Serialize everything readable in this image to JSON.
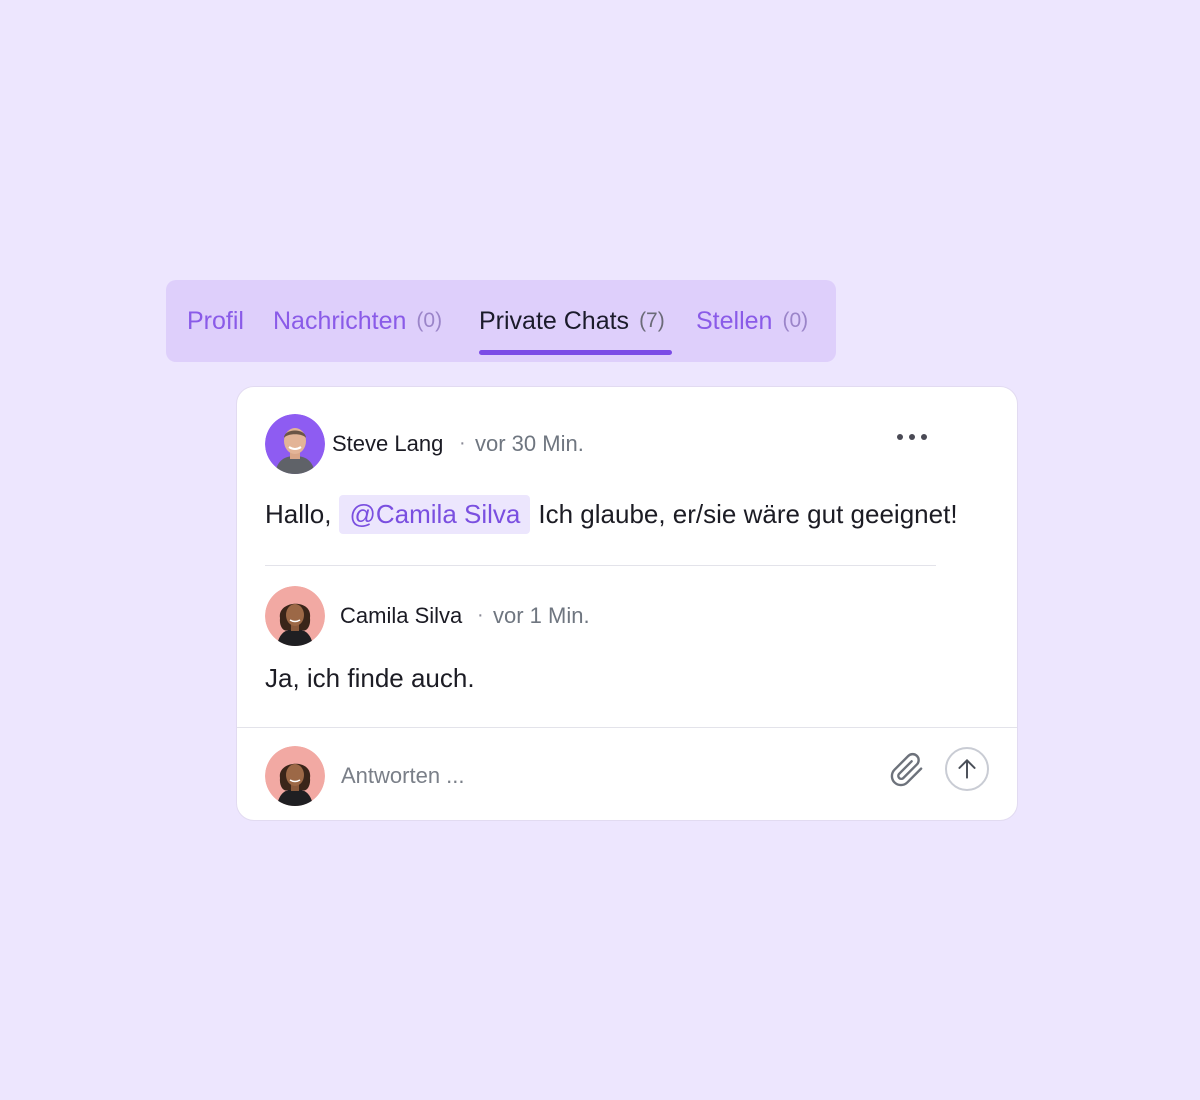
{
  "tabs": [
    {
      "label": "Profil",
      "count": ""
    },
    {
      "label": "Nachrichten",
      "count": "(0)"
    },
    {
      "label": "Private Chats",
      "count": "(7)"
    },
    {
      "label": "Stellen",
      "count": "(0)"
    }
  ],
  "active_tab": "Private Chats",
  "thread": {
    "message1": {
      "author": "Steve Lang",
      "separator": "·",
      "time": "vor 30 Min.",
      "text_before": "Hallo,",
      "mention": "@Camila Silva",
      "text_after": "Ich glaube, er/sie wäre gut geeignet!"
    },
    "message2": {
      "author": "Camila Silva",
      "separator": "·",
      "time": "vor 1 Min.",
      "text": "Ja, ich finde auch."
    }
  },
  "reply": {
    "placeholder": "Antworten ..."
  },
  "colors": {
    "background": "#ede6fe",
    "tab_bar": "#decffb",
    "accent": "#7b4ce6",
    "mention_bg": "#ece6fd"
  },
  "icons": {
    "more": "more-horizontal-icon",
    "attach": "paperclip-icon",
    "send": "arrow-up-icon"
  }
}
